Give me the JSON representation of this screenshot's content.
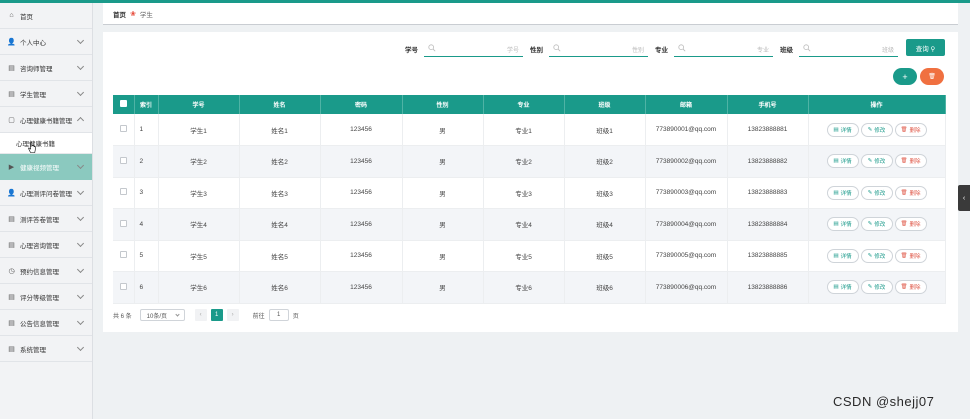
{
  "sidebar": {
    "items": [
      {
        "label": "首页",
        "icon": "home-icon",
        "glyph": "⌂",
        "chevron": false
      },
      {
        "label": "个人中心",
        "icon": "user-icon",
        "glyph": "👤",
        "chevron": true
      },
      {
        "label": "咨询师管理",
        "icon": "list-icon",
        "glyph": "▤",
        "chevron": true
      },
      {
        "label": "学生管理",
        "icon": "list-icon",
        "glyph": "▤",
        "chevron": true
      },
      {
        "label": "心理健康书籍管理",
        "icon": "book-icon",
        "glyph": "▢",
        "chevron": true,
        "open": true
      },
      {
        "label": "健康视频管理",
        "icon": "video-icon",
        "glyph": "▶",
        "chevron": true
      },
      {
        "label": "心理测评问卷管理",
        "icon": "user-icon",
        "glyph": "👤",
        "chevron": true
      },
      {
        "label": "测评答卷管理",
        "icon": "list-icon",
        "glyph": "▤",
        "chevron": true
      },
      {
        "label": "心理咨询管理",
        "icon": "list-icon",
        "glyph": "▤",
        "chevron": true
      },
      {
        "label": "预约信息管理",
        "icon": "clock-icon",
        "glyph": "◷",
        "chevron": true
      },
      {
        "label": "评分等级管理",
        "icon": "list-icon",
        "glyph": "▤",
        "chevron": true
      },
      {
        "label": "公告信息管理",
        "icon": "list-icon",
        "glyph": "▤",
        "chevron": true
      },
      {
        "label": "系统管理",
        "icon": "list-icon",
        "glyph": "▤",
        "chevron": true
      }
    ],
    "submenu": {
      "label": "心理健康书籍"
    }
  },
  "breadcrumb": {
    "home": "首页",
    "separator": "❀",
    "current": "学生"
  },
  "search": {
    "fields": [
      {
        "label": "学号",
        "placeholder": "学号"
      },
      {
        "label": "性别",
        "placeholder": "性别"
      },
      {
        "label": "专业",
        "placeholder": "专业"
      },
      {
        "label": "班级",
        "placeholder": "班级"
      }
    ],
    "query_label": "查询 ⚲"
  },
  "actions": {
    "add_label": "+",
    "delete_label": "🗑"
  },
  "table": {
    "headers": [
      "索引",
      "学号",
      "姓名",
      "密码",
      "性别",
      "专业",
      "班级",
      "邮箱",
      "手机号",
      "操作"
    ],
    "rows": [
      [
        "1",
        "学生1",
        "姓名1",
        "123456",
        "男",
        "专业1",
        "班级1",
        "773890001@qq.com",
        "13823888881"
      ],
      [
        "2",
        "学生2",
        "姓名2",
        "123456",
        "男",
        "专业2",
        "班级2",
        "773890002@qq.com",
        "13823888882"
      ],
      [
        "3",
        "学生3",
        "姓名3",
        "123456",
        "男",
        "专业3",
        "班级3",
        "773890003@qq.com",
        "13823888883"
      ],
      [
        "4",
        "学生4",
        "姓名4",
        "123456",
        "男",
        "专业4",
        "班级4",
        "773890004@qq.com",
        "13823888884"
      ],
      [
        "5",
        "学生5",
        "姓名5",
        "123456",
        "男",
        "专业5",
        "班级5",
        "773890005@qq.com",
        "13823888885"
      ],
      [
        "6",
        "学生6",
        "姓名6",
        "123456",
        "男",
        "专业6",
        "班级6",
        "773890006@qq.com",
        "13823888886"
      ]
    ],
    "row_actions": [
      {
        "label": "详情",
        "glyph": "▤"
      },
      {
        "label": "修改",
        "glyph": "✎"
      },
      {
        "label": "删除",
        "glyph": "🗑"
      }
    ]
  },
  "pager": {
    "total": "共 6 条",
    "page_size": "10条/页",
    "prev": "‹",
    "current_page": "1",
    "next": "›",
    "goto_prefix": "前往",
    "goto_value": "1",
    "goto_suffix": "页"
  },
  "side_tab": {
    "glyph": "‹"
  },
  "watermark": "CSDN @shejj07",
  "colors": {
    "primary": "#1a9a8a",
    "danger": "#f07040",
    "active_menu": "#8bc9bf"
  }
}
